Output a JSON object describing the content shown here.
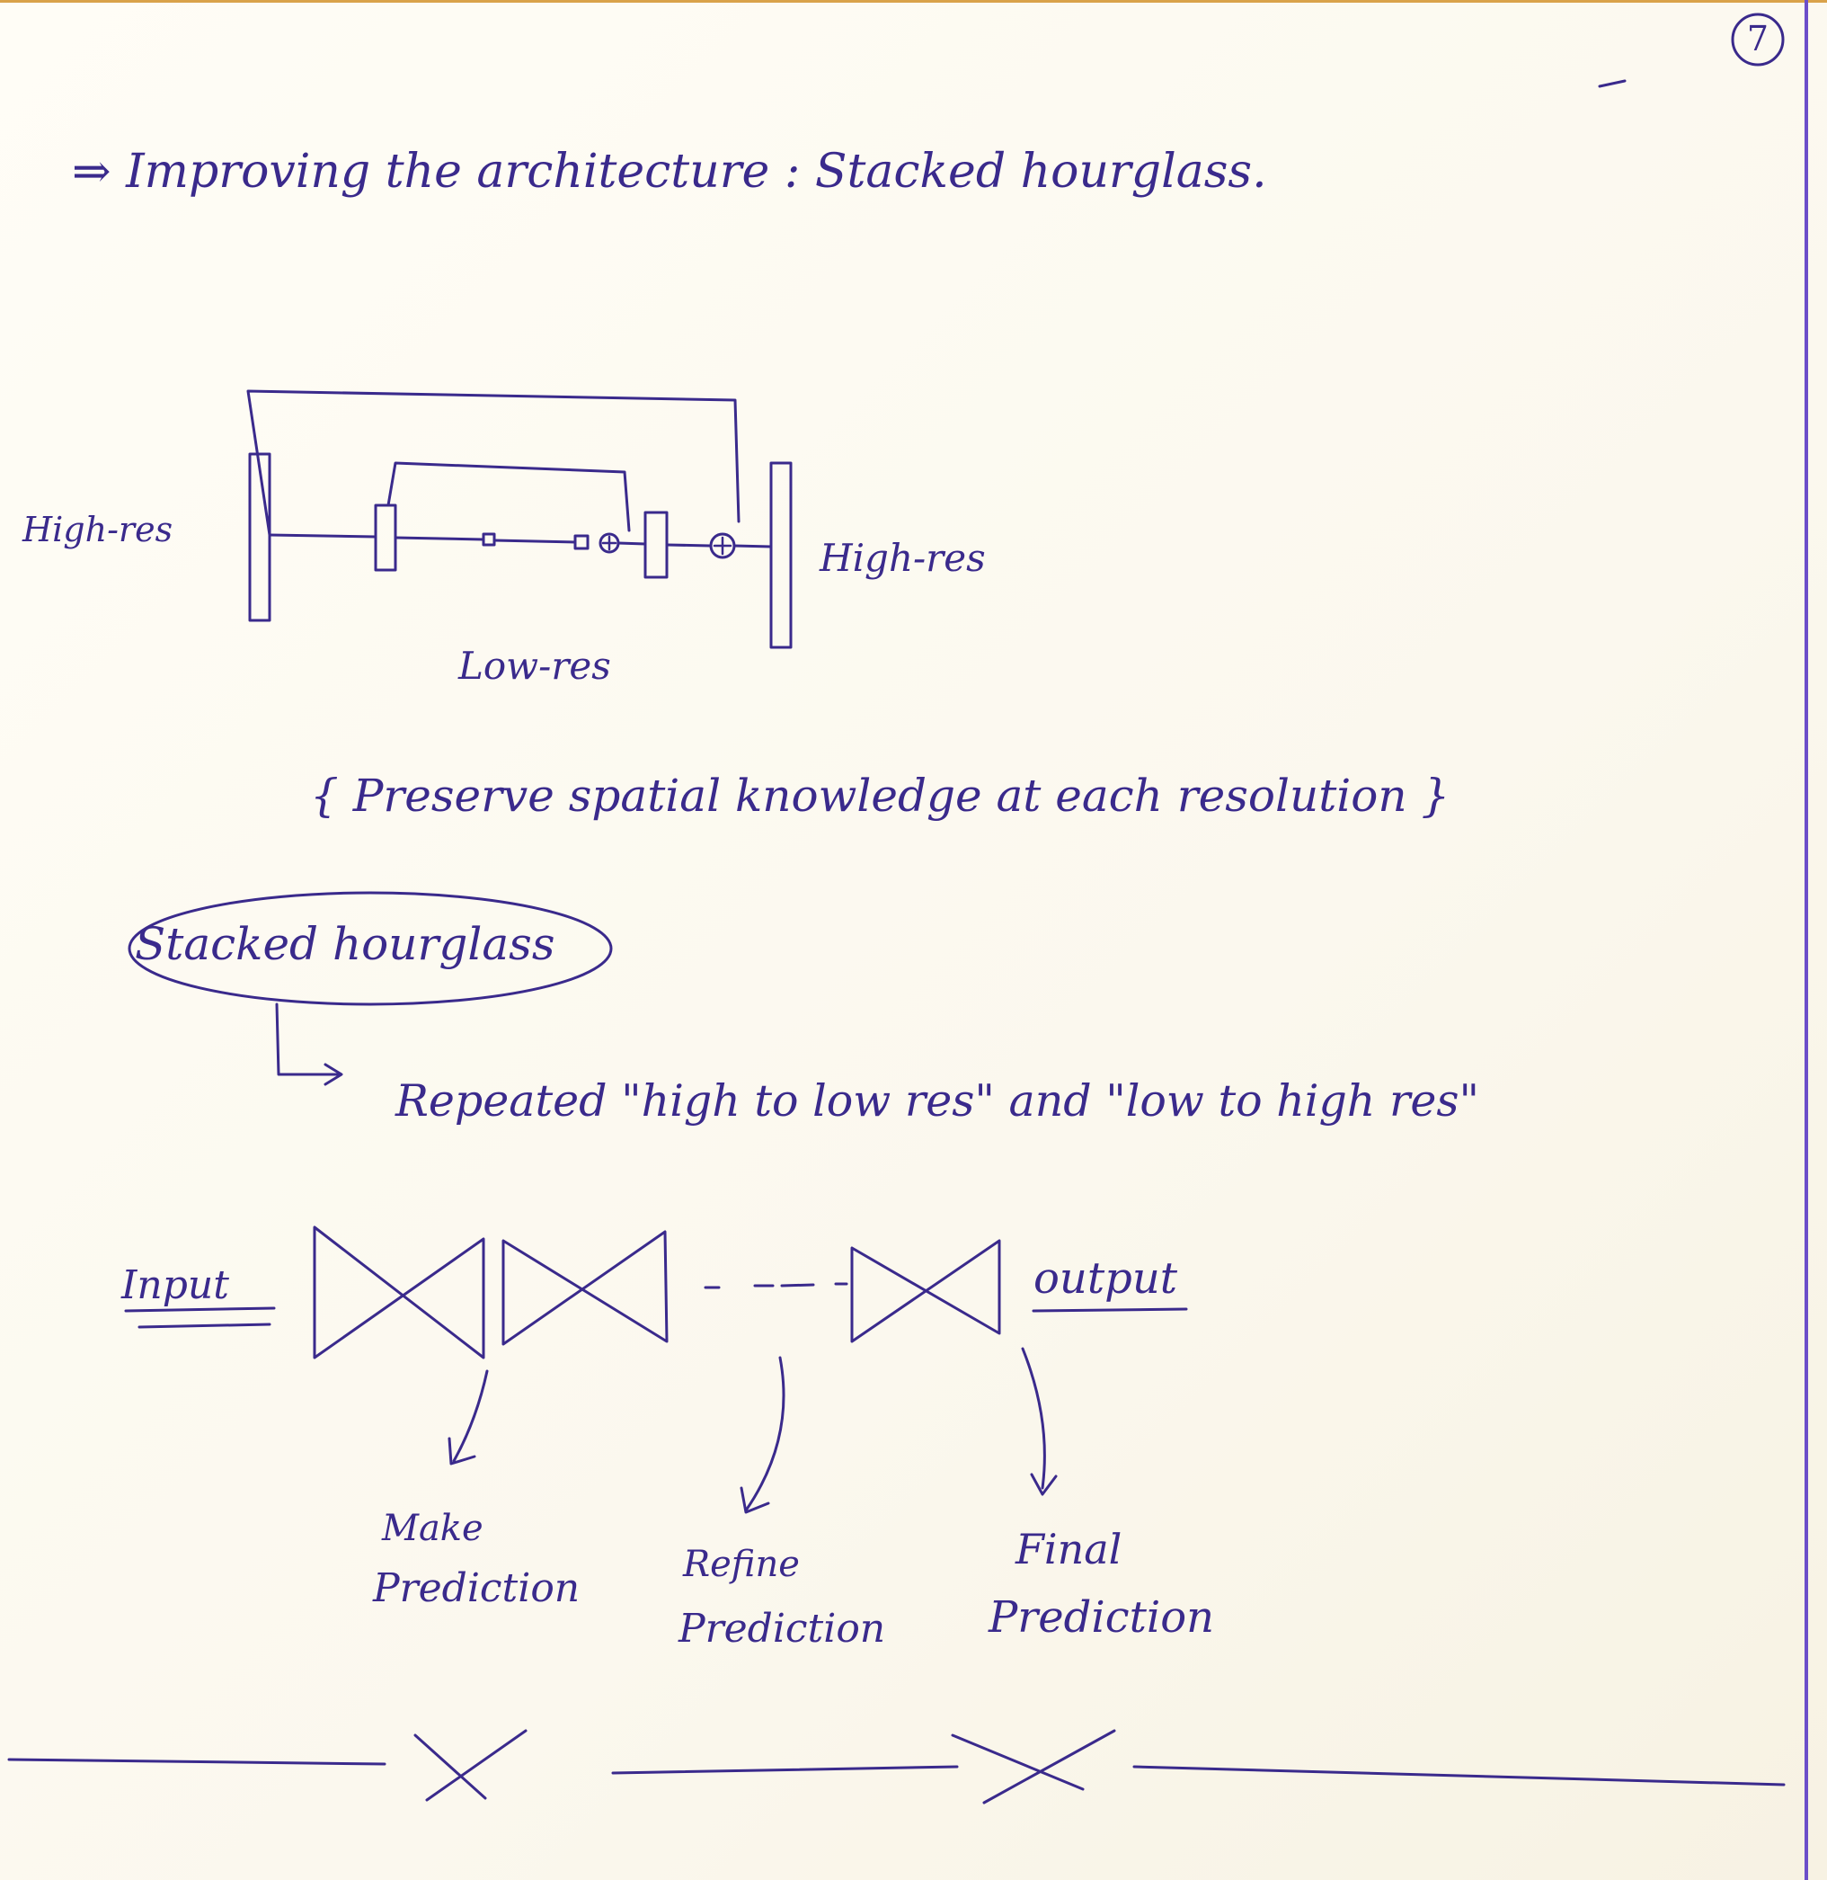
{
  "page_number": "7",
  "heading": "⇒ Improving the architecture : Stacked hourglass.",
  "diagram1": {
    "label_left": "High-res",
    "label_right": "High-res",
    "label_bottom": "Low-res"
  },
  "note": "{ Preserve spatial knowledge at each resolution }",
  "concept": {
    "label": "Stacked hourglass",
    "description": "Repeated \"high to low res\" and \"low to high res\""
  },
  "diagram2": {
    "input_label": "Input",
    "output_label": "output",
    "dashes": "- - - -",
    "steps": [
      {
        "line1": "Make",
        "line2": "Prediction"
      },
      {
        "line1": "Refine",
        "line2": "Prediction"
      },
      {
        "line1": "Final",
        "line2": "Prediction"
      }
    ]
  },
  "colors": {
    "ink": "#3a2a8c",
    "paper": "#fdfcf7",
    "margin_line": "#6c4ec9"
  }
}
